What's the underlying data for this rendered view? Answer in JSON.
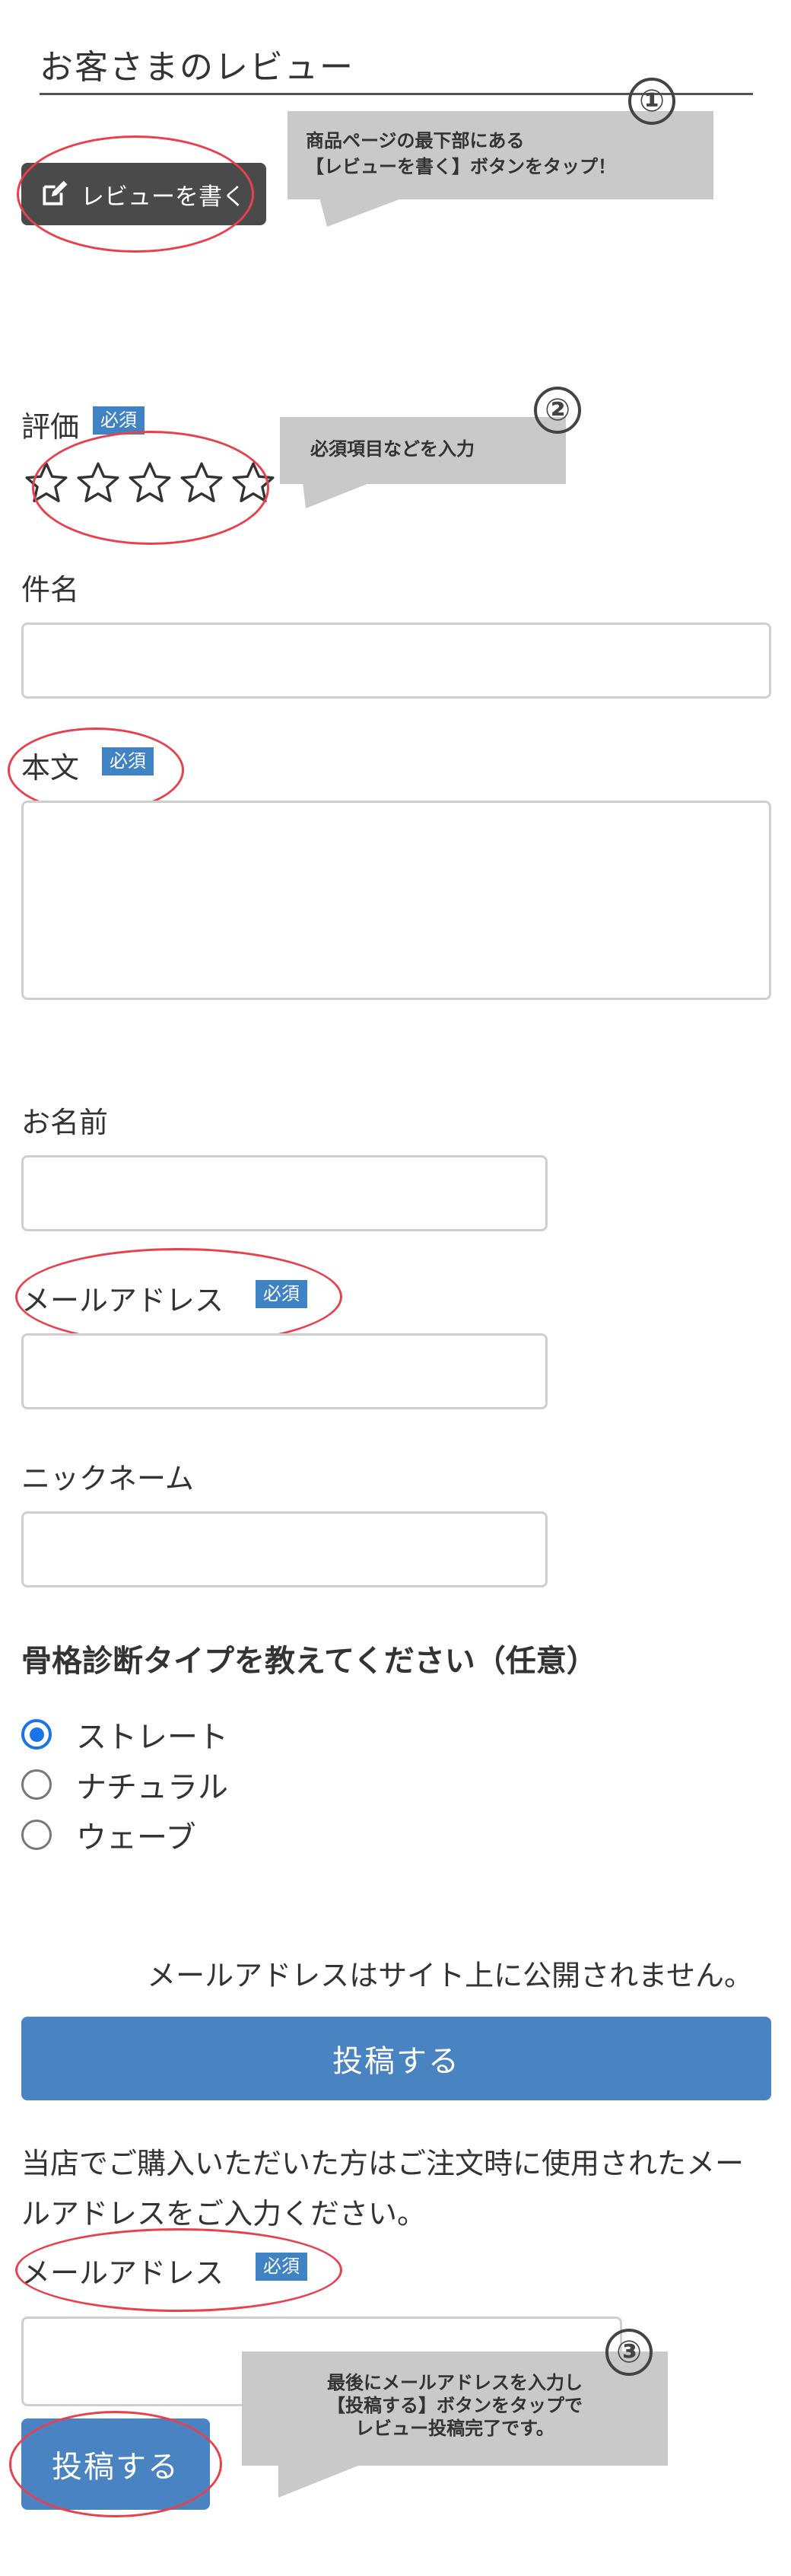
{
  "header": {
    "title": "お客さまのレビュー"
  },
  "write_review_button": {
    "label": "レビューを書く",
    "icon": "edit-icon"
  },
  "callouts": [
    {
      "number": "①",
      "text_line1": "商品ページの最下部にある",
      "text_line2": "【レビューを書く】ボタンをタップ！"
    },
    {
      "number": "②",
      "text_line1": "必須項目などを入力"
    },
    {
      "number": "③",
      "text_line1": "最後にメールアドレスを入力し",
      "text_line2": "【投稿する】ボタンをタップで",
      "text_line3": "レビュー投稿完了です。"
    }
  ],
  "form": {
    "rating_label": "評価",
    "required_badge": "必須",
    "rating_value": 0,
    "rating_max": 5,
    "subject_label": "件名",
    "subject_value": "",
    "body_label": "本文",
    "body_value": "",
    "name_label": "お名前",
    "name_value": "",
    "email_label": "メールアドレス",
    "email_value": "",
    "nickname_label": "ニックネーム",
    "nickname_value": ""
  },
  "question": {
    "text": "骨格診断タイプを教えてください（任意）",
    "options": [
      {
        "label": "ストレート",
        "checked": true
      },
      {
        "label": "ナチュラル",
        "checked": false
      },
      {
        "label": "ウェーブ",
        "checked": false
      }
    ]
  },
  "notice": "メールアドレスはサイト上に公開されません。",
  "submit_label": "投稿する",
  "confirm": {
    "help_text": "当店でご購入いただいた方はご注文時に使用されたメールアドレスをご入力ください。",
    "email_label": "メールアドレス",
    "email_value": "",
    "submit_label": "投稿する"
  },
  "colors": {
    "accent_blue": "#4a83c1",
    "badge_blue": "#3f83c4",
    "radio_blue": "#1a73e8",
    "annotation_red": "#e8414d",
    "callout_gray": "#c9c9c9",
    "dark_button": "#4a4a4a"
  }
}
